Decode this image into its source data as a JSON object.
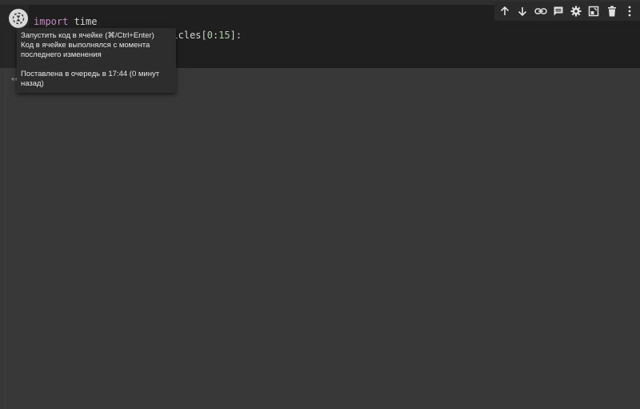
{
  "cell": {
    "code_lines": [
      {
        "tokens": [
          {
            "text": "import",
            "kind": "keyword"
          },
          {
            "text": " time",
            "kind": "plain"
          }
        ]
      },
      {
        "tokens": [
          {
            "text": "                        ",
            "kind": "plain"
          },
          {
            "text": "icles[",
            "kind": "plain"
          },
          {
            "text": "0",
            "kind": "number"
          },
          {
            "text": ":",
            "kind": "plain"
          },
          {
            "text": "15",
            "kind": "number"
          },
          {
            "text": "]:",
            "kind": "plain"
          }
        ]
      }
    ],
    "run_button_icon": "hourglass-pending-icon",
    "exec_indicator": "↔"
  },
  "tooltip": {
    "line1": "Запустить код в ячейке (⌘/Ctrl+Enter)",
    "line2": "Код в ячейке выполнялся с момента",
    "line3": "последнего изменения",
    "line4": "Поставлена в очередь в 17:44 (0 минут",
    "line5": "назад)"
  },
  "toolbar": {
    "buttons": [
      {
        "name": "move-up",
        "icon": "arrow-up-icon"
      },
      {
        "name": "move-down",
        "icon": "arrow-down-icon"
      },
      {
        "name": "link",
        "icon": "link-icon"
      },
      {
        "name": "comment",
        "icon": "comment-icon"
      },
      {
        "name": "settings",
        "icon": "gear-icon"
      },
      {
        "name": "mirror",
        "icon": "mirror-cell-icon"
      },
      {
        "name": "delete",
        "icon": "trash-icon"
      },
      {
        "name": "more",
        "icon": "more-vert-icon"
      }
    ]
  },
  "colors": {
    "cell_background": "#1f1f1f",
    "page_background": "#383838",
    "keyword": "#c586c0",
    "number": "#b5cea8",
    "tooltip_background": "#2d2d2d"
  }
}
